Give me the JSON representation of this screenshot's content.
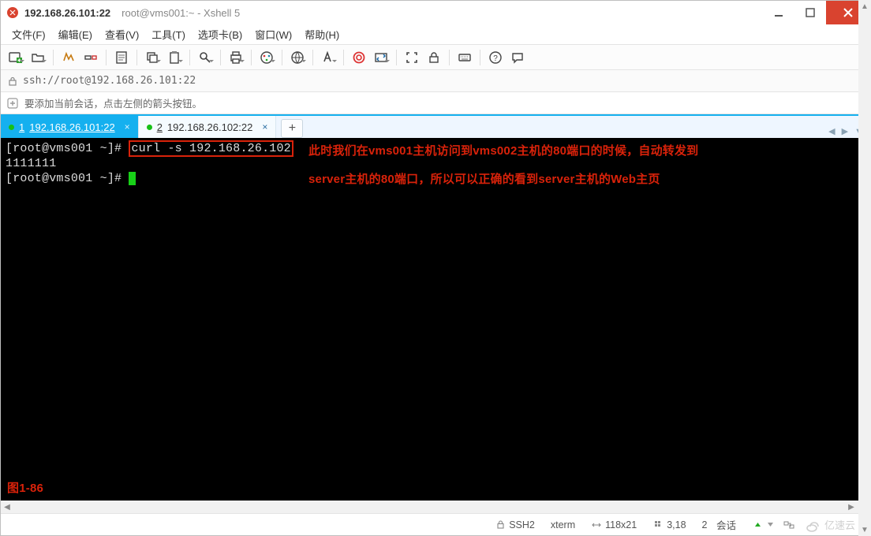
{
  "titlebar": {
    "title": "192.168.26.101:22",
    "subtitle": "root@vms001:~ - Xshell 5"
  },
  "menu": {
    "file": "文件(F)",
    "edit": "编辑(E)",
    "view": "查看(V)",
    "tools": "工具(T)",
    "tabs": "选项卡(B)",
    "window": "窗口(W)",
    "help": "帮助(H)"
  },
  "address": {
    "url": "ssh://root@192.168.26.101:22"
  },
  "hint": {
    "text": "要添加当前会话，点击左侧的箭头按钮。"
  },
  "tabs": {
    "t1": {
      "index": "1",
      "label": "192.168.26.101:22"
    },
    "t2": {
      "index": "2",
      "label": "192.168.26.102:22"
    },
    "add": "+"
  },
  "terminal": {
    "line1_prompt": "[root@vms001 ~]# ",
    "line1_cmd": "curl -s 192.168.26.102",
    "line2": "1111111",
    "line3_prompt": "[root@vms001 ~]# "
  },
  "annotation": {
    "line1": "此时我们在vms001主机访问到vms002主机的80端口的时候，自动转发到",
    "line2": "server主机的80端口，所以可以正确的看到server主机的Web主页",
    "figcap": "图1-86"
  },
  "status": {
    "proto": "SSH2",
    "term": "xterm",
    "size": "118x21",
    "cursor": "3,18",
    "sessions_count": "2",
    "sessions_label": "会话"
  },
  "watermark": "亿速云",
  "icons": {
    "app": "xshell",
    "min": "minimize",
    "max": "maximize",
    "close": "close",
    "lock": "lock",
    "arrow": "add-session",
    "size_lr": "resize",
    "caret_up": "caret-up",
    "caret_dn": "caret-down"
  }
}
